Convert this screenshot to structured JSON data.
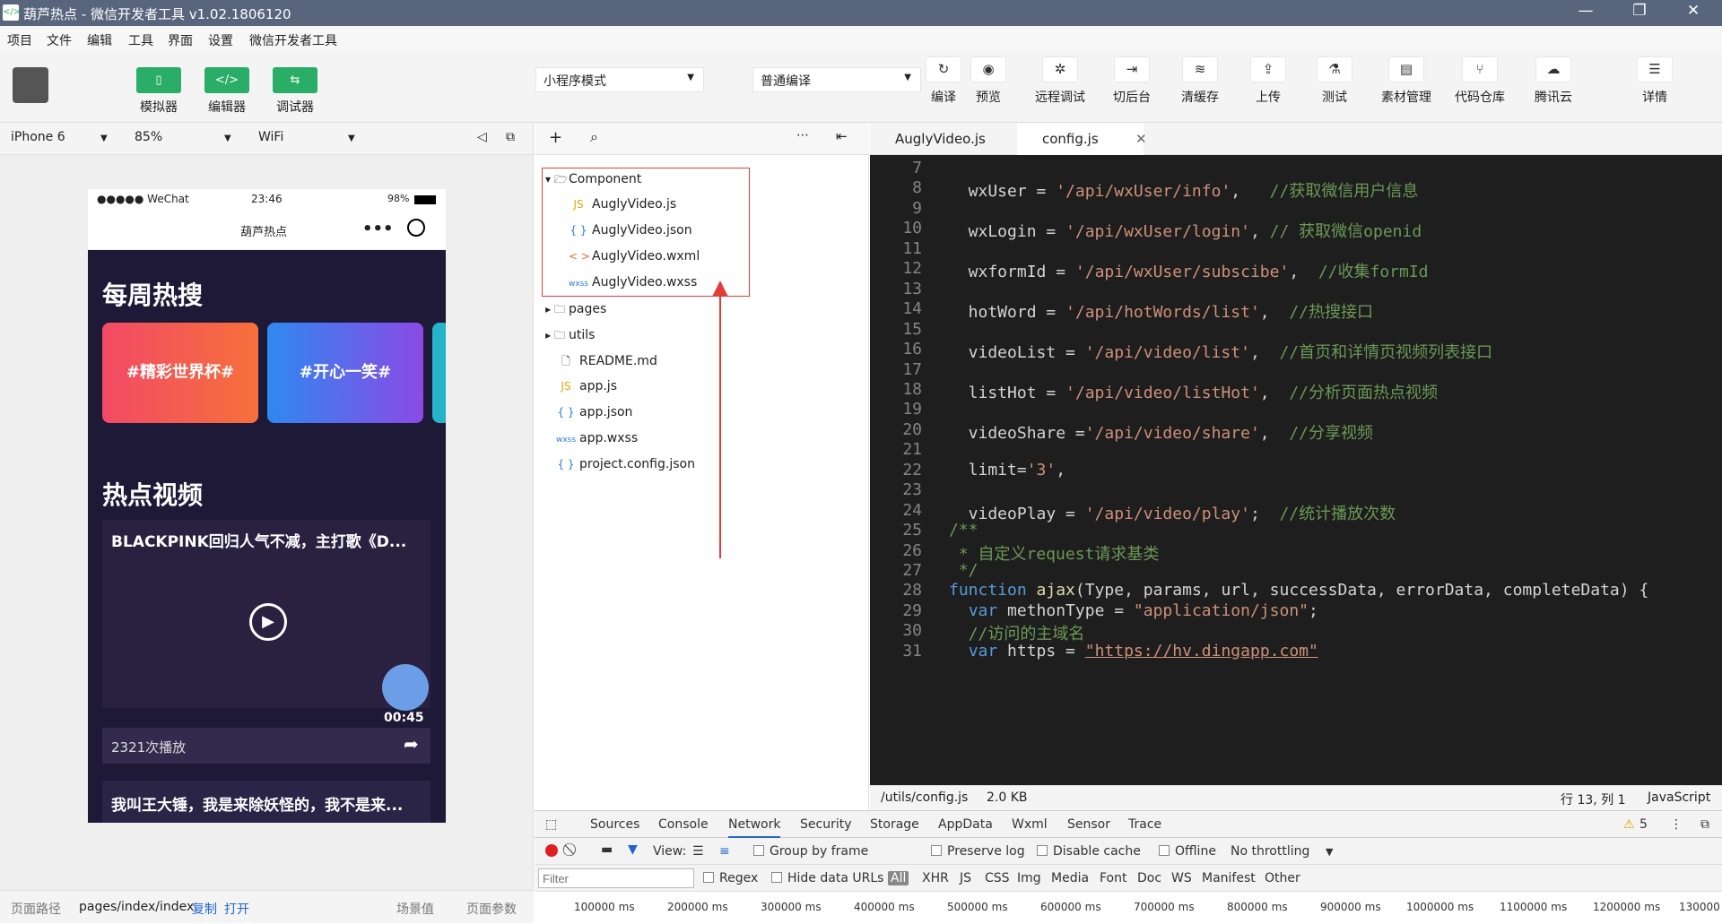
{
  "window": {
    "title": "葫芦热点 - 微信开发者工具 v1.02.1806120",
    "minimize": "—",
    "restore": "❐",
    "close": "✕"
  },
  "menu": [
    "项目",
    "文件",
    "编辑",
    "工具",
    "界面",
    "设置",
    "微信开发者工具"
  ],
  "toolbar": {
    "simulator": "模拟器",
    "editor": "编辑器",
    "debugger": "调试器",
    "mode": "小程序模式",
    "compile_mode": "普通编译",
    "tools": [
      "编译",
      "预览",
      "远程调试",
      "切后台",
      "清缓存",
      "上传",
      "测试",
      "素材管理",
      "代码仓库",
      "腾讯云",
      "详情"
    ]
  },
  "device": {
    "model": "iPhone 6",
    "zoom": "85%",
    "network": "WiFi"
  },
  "phone": {
    "carrier": "●●●●● WeChat",
    "time": "23:46",
    "battery": "98%",
    "nav_title": "葫芦热点",
    "more": "•••",
    "section1": "每周热搜",
    "cards": [
      "#精彩世界杯#",
      "#开心一笑#"
    ],
    "section2": "热点视频",
    "video_title": "BLACKPINK回归人气不减，主打歌《D...",
    "duration": "00:45",
    "plays": "2321次播放",
    "video2_title": "我叫王大锤，我是来除妖怪的，我不是来..."
  },
  "filetree": {
    "items": [
      {
        "name": "Component",
        "icon": "▾ 🗁"
      },
      {
        "name": "AuglyVideo.js",
        "icon": "JS"
      },
      {
        "name": "AuglyVideo.json",
        "icon": "{ }"
      },
      {
        "name": "AuglyVideo.wxml",
        "icon": "< >"
      },
      {
        "name": "AuglyVideo.wxss",
        "icon": "wxss"
      },
      {
        "name": "pages",
        "icon": "▸ 🗀"
      },
      {
        "name": "utils",
        "icon": "▸ 🗀"
      },
      {
        "name": "README.md",
        "icon": "🗋"
      },
      {
        "name": "app.js",
        "icon": "JS"
      },
      {
        "name": "app.json",
        "icon": "{ }"
      },
      {
        "name": "app.wxss",
        "icon": "wxss"
      },
      {
        "name": "project.config.json",
        "icon": "{ }"
      }
    ]
  },
  "tabs": [
    {
      "label": "AuglyVideo.js"
    },
    {
      "label": "config.js",
      "active": true
    }
  ],
  "code": {
    "lines": [
      "7",
      "8",
      "9",
      "10",
      "11",
      "12",
      "13",
      "14",
      "15",
      "16",
      "17",
      "18",
      "19",
      "20",
      "21",
      "22",
      "23",
      "24",
      "25",
      "26",
      "27",
      "28",
      "29",
      "30",
      "31"
    ]
  },
  "editor_status": {
    "path": "/utils/config.js",
    "size": "2.0 KB",
    "cursor": "行 13, 列 1",
    "lang": "JavaScript"
  },
  "devtools": {
    "tabs": [
      "Sources",
      "Console",
      "Network",
      "Security",
      "Storage",
      "AppData",
      "Wxml",
      "Sensor",
      "Trace"
    ],
    "warn_count": "5",
    "view": "View:",
    "group": "Group by frame",
    "preserve": "Preserve log",
    "cache": "Disable cache",
    "offline": "Offline",
    "throttle": "No throttling",
    "filter_placeholder": "Filter",
    "regex": "Regex",
    "hide": "Hide data URLs",
    "types": [
      "All",
      "XHR",
      "JS",
      "CSS",
      "Img",
      "Media",
      "Font",
      "Doc",
      "WS",
      "Manifest",
      "Other"
    ],
    "timeline": [
      "100000 ms",
      "200000 ms",
      "300000 ms",
      "400000 ms",
      "500000 ms",
      "600000 ms",
      "700000 ms",
      "800000 ms",
      "900000 ms",
      "1000000 ms",
      "1100000 ms",
      "1200000 ms",
      "130000"
    ]
  },
  "bottom": {
    "path_label": "页面路径",
    "path": "pages/index/index",
    "copy": "复制",
    "open": "打开",
    "scene": "场景值",
    "params": "页面参数"
  }
}
